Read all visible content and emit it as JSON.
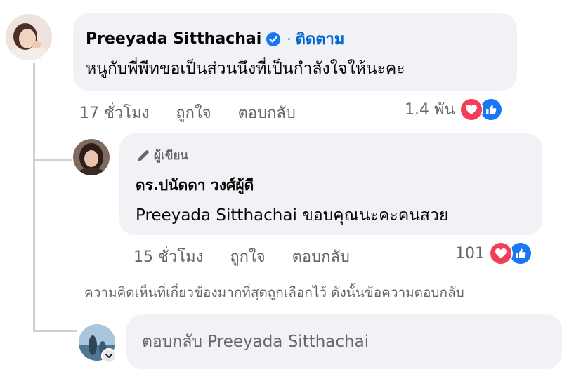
{
  "top_comment": {
    "author": "Preeyada Sitthachai",
    "follow_label": "ติดตาม",
    "separator": "·",
    "text": "หนูกับพี่พีทขอเป็นส่วนนึงที่เป็นกำลังใจให้นะคะ",
    "time": "17 ชั่วโมง",
    "like_label": "ถูกใจ",
    "reply_label": "ตอบกลับ",
    "reaction_count": "1.4 พัน",
    "reactions": [
      "love-icon",
      "like-icon"
    ]
  },
  "reply": {
    "badge_label": "ผู้เขียน",
    "author": "ดร.ปนัดดา วงศ์ผู้ดี",
    "text": "Preeyada Sitthachai ขอบคุณนะคะคนสวย",
    "time": "15 ชั่วโมง",
    "like_label": "ถูกใจ",
    "reply_label": "ตอบกลับ",
    "reaction_count": "101",
    "reactions": [
      "love-icon",
      "like-icon"
    ]
  },
  "notice": "ความคิดเห็นที่เกี่ยวข้องมากที่สุดถูกเลือกไว้ ดังนั้นข้อความตอบกลับ",
  "reply_box": {
    "placeholder": "ตอบกลับ Preeyada Sitthachai"
  },
  "colors": {
    "bubble": "#f0f2f5",
    "link": "#0064d1",
    "muted": "#65676b",
    "love": "#f33e58",
    "like": "#1877f2"
  }
}
